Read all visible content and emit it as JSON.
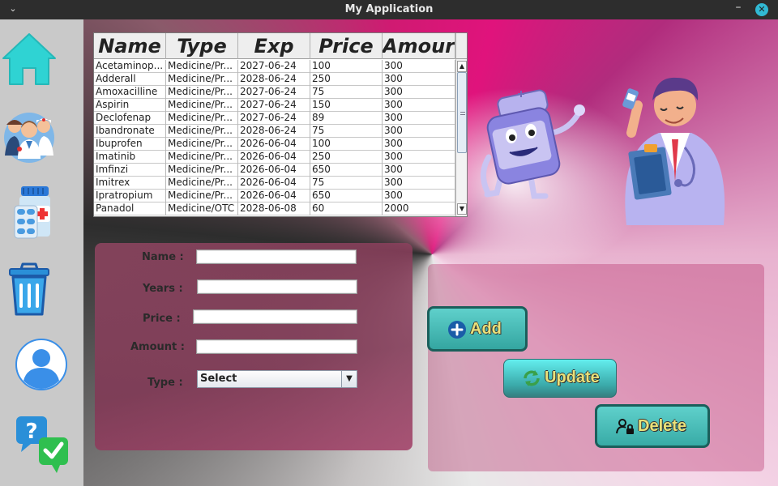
{
  "window": {
    "title": "My Application",
    "menu_icon": "chevron-down-icon",
    "minimize_icon": "minimize-icon",
    "close_icon": "close-icon"
  },
  "sidebar": {
    "items": [
      {
        "name": "home",
        "icon": "home-icon",
        "color": "#2fd3d3"
      },
      {
        "name": "staff",
        "icon": "medical-staff-icon"
      },
      {
        "name": "medicines",
        "icon": "medicine-bottle-icon"
      },
      {
        "name": "delete",
        "icon": "trash-icon",
        "color": "#2a8fd8"
      },
      {
        "name": "profile",
        "icon": "user-avatar-icon",
        "color": "#3a8fe8"
      },
      {
        "name": "faq",
        "icon": "question-answer-icon"
      }
    ]
  },
  "table": {
    "columns": [
      "Name",
      "Type",
      "Exp",
      "Price",
      "Amour"
    ],
    "rows": [
      [
        "Acetaminop...",
        "Medicine/Pr...",
        "2027-06-24",
        "100",
        "300"
      ],
      [
        "Adderall",
        "Medicine/Pr...",
        "2028-06-24",
        "250",
        "300"
      ],
      [
        "Amoxacilline",
        "Medicine/Pr...",
        "2027-06-24",
        "75",
        "300"
      ],
      [
        "Aspirin",
        "Medicine/Pr...",
        "2027-06-24",
        "150",
        "300"
      ],
      [
        "Declofenap",
        "Medicine/Pr...",
        "2027-06-24",
        "89",
        "300"
      ],
      [
        "Ibandronate",
        "Medicine/Pr...",
        "2028-06-24",
        "75",
        "300"
      ],
      [
        "Ibuprofen",
        "Medicine/Pr...",
        "2026-06-04",
        "100",
        "300"
      ],
      [
        "Imatinib",
        "Medicine/Pr...",
        "2026-06-04",
        "250",
        "300"
      ],
      [
        "Imfinzi",
        "Medicine/Pr...",
        "2026-06-04",
        "650",
        "300"
      ],
      [
        "Imitrex",
        "Medicine/Pr...",
        "2026-06-04",
        "75",
        "300"
      ],
      [
        "Ipratropium",
        "Medicine/Pr...",
        "2026-06-04",
        "650",
        "300"
      ],
      [
        "Panadol",
        "Medicine/OTC",
        "2028-06-08",
        "60",
        "2000"
      ]
    ]
  },
  "form": {
    "name_label": "Name :",
    "years_label": "Years :",
    "price_label": "Price :",
    "amount_label": "Amount :",
    "type_label": "Type :",
    "name_value": "",
    "years_value": "",
    "price_value": "",
    "amount_value": "",
    "type_selected": "Select"
  },
  "buttons": {
    "add_label": "Add",
    "update_label": "Update",
    "delete_label": "Delete",
    "add_icon": "plus-circle-icon",
    "update_icon": "refresh-icon",
    "delete_icon": "user-lock-icon"
  },
  "colors": {
    "button_bg": "#3fbcb6",
    "button_text": "#e9e17a",
    "accent_pink": "#e0137c"
  }
}
